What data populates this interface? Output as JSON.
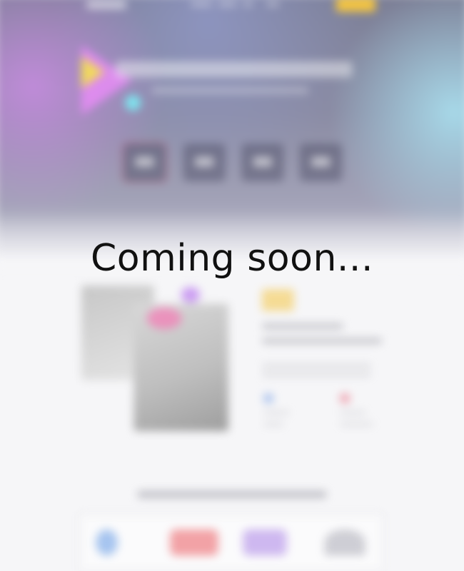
{
  "overlay": {
    "message": "Coming soon..."
  },
  "colors": {
    "hero_base": "#7c7f96",
    "accent_yellow": "#f4c542",
    "accent_pink": "#e68cf5",
    "accent_cyan": "#7fe3ee",
    "page_background": "#f6f6f8",
    "message_text": "#111111"
  }
}
